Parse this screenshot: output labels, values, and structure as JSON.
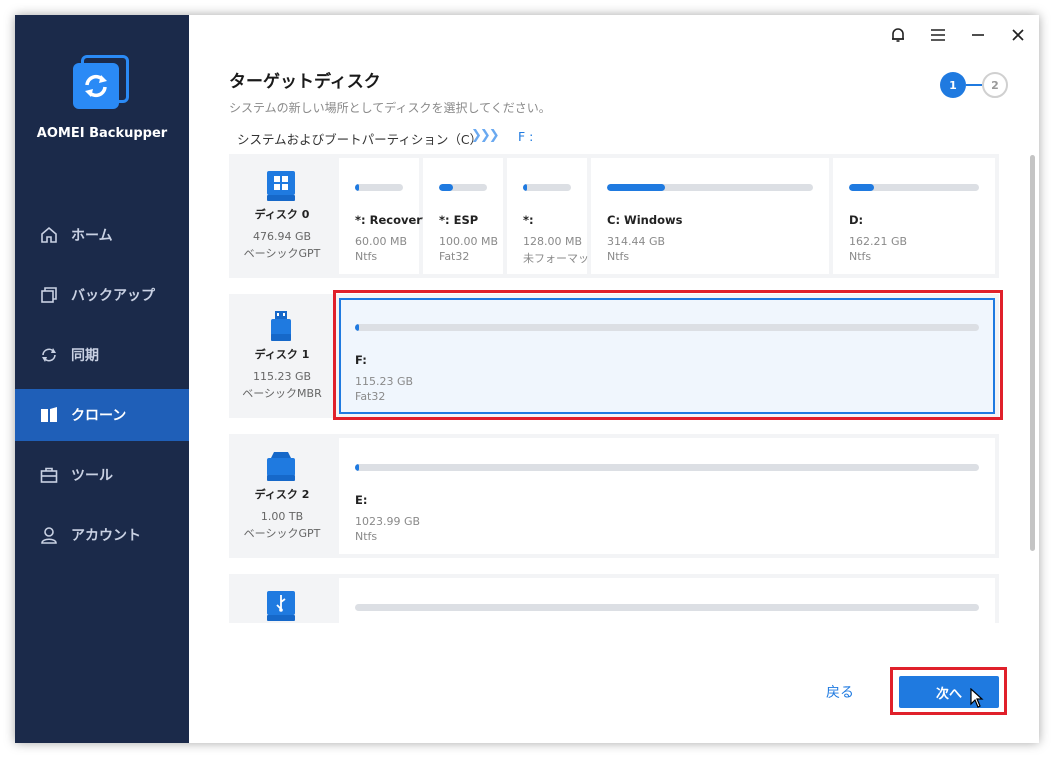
{
  "app": {
    "name": "AOMEI Backupper",
    "accent": "#1f7ae0",
    "sidebar_bg": "#1b2a4a",
    "highlight": "#e0202a"
  },
  "titlebar": {
    "icons": [
      "bell-icon",
      "menu-icon",
      "minimize-icon",
      "close-icon"
    ]
  },
  "nav": {
    "items": [
      {
        "label": "ホーム",
        "icon": "home-icon",
        "active": false
      },
      {
        "label": "バックアップ",
        "icon": "backup-icon",
        "active": false
      },
      {
        "label": "同期",
        "icon": "sync-icon",
        "active": false
      },
      {
        "label": "クローン",
        "icon": "clone-icon",
        "active": true
      },
      {
        "label": "ツール",
        "icon": "toolbox-icon",
        "active": false
      },
      {
        "label": "アカウント",
        "icon": "user-icon",
        "active": false
      }
    ]
  },
  "page": {
    "title": "ターゲットディスク",
    "subtitle": "システムの新しい場所としてディスクを選択してください。",
    "steps": [
      "1",
      "2"
    ],
    "route_from": "システムおよびブートパーティション（C）",
    "route_arrows": "❯❯❯",
    "route_to": "F :"
  },
  "disks": [
    {
      "name": "ディスク 0",
      "size": "476.94 GB",
      "type": "ベーシックGPT",
      "icon": "windows-disk-icon",
      "partitions": [
        {
          "name": "*: Recovery",
          "size": "60.00 MB",
          "fs": "Ntfs",
          "used": 0.08
        },
        {
          "name": "*: ESP",
          "size": "100.00 MB",
          "fs": "Fat32",
          "used": 0.3
        },
        {
          "name": "*:",
          "size": "128.00 MB",
          "fs": "未フォーマット",
          "used": 0.05
        },
        {
          "name": "C: Windows",
          "size": "314.44 GB",
          "fs": "Ntfs",
          "used": 0.28
        },
        {
          "name": "D:",
          "size": "162.21 GB",
          "fs": "Ntfs",
          "used": 0.19
        }
      ]
    },
    {
      "name": "ディスク 1",
      "size": "115.23 GB",
      "type": "ベーシックMBR",
      "icon": "usb-drive-icon",
      "partitions": [
        {
          "name": "F:",
          "size": "115.23 GB",
          "fs": "Fat32",
          "used": 0.005,
          "selected": true
        }
      ]
    },
    {
      "name": "ディスク 2",
      "size": "1.00 TB",
      "type": "ベーシックGPT",
      "icon": "hard-disk-icon",
      "partitions": [
        {
          "name": "E:",
          "size": "1023.99 GB",
          "fs": "Ntfs",
          "used": 0.005
        }
      ]
    },
    {
      "name": "",
      "size": "",
      "type": "",
      "icon": "usb-disk-icon",
      "partitions": [
        {
          "name": "",
          "size": "",
          "fs": "",
          "used": 0
        }
      ]
    }
  ],
  "footer": {
    "back_label": "戻る",
    "next_label": "次へ"
  }
}
